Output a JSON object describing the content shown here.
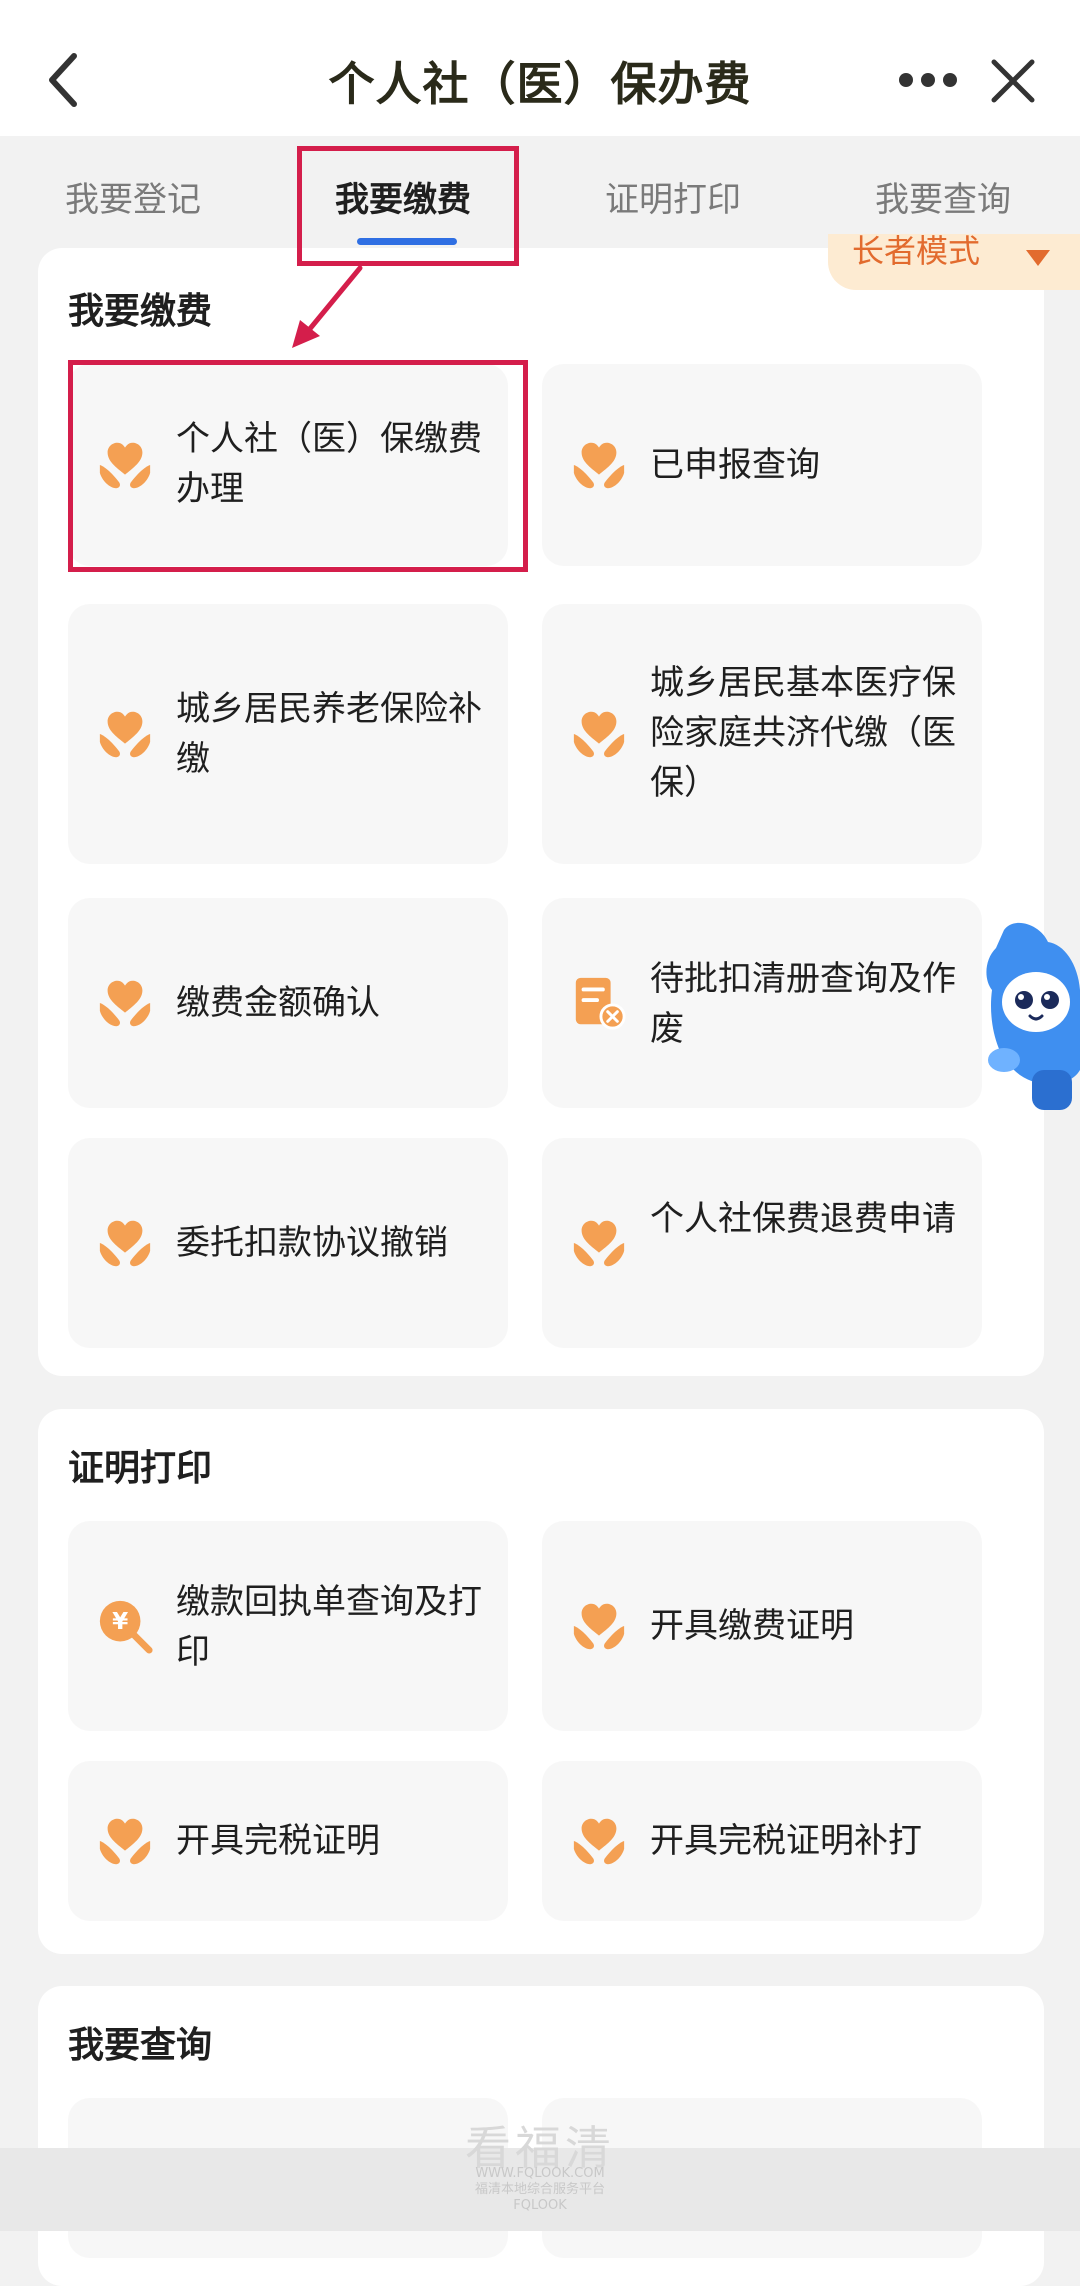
{
  "header": {
    "title": "个人社（医）保办费",
    "back_icon": "chevron-left-icon",
    "more_icon": "more-dots-icon",
    "close_icon": "close-icon"
  },
  "tabs": [
    {
      "label": "我要登记",
      "active": false
    },
    {
      "label": "我要缴费",
      "active": true
    },
    {
      "label": "证明打印",
      "active": false
    },
    {
      "label": "我要查询",
      "active": false
    }
  ],
  "mode_badge": "长者模式",
  "sections": [
    {
      "title": "我要缴费",
      "items": [
        {
          "label": "个人社（医）保缴费办理",
          "icon": "heart-hands-icon"
        },
        {
          "label": "已申报查询",
          "icon": "heart-hands-icon"
        },
        {
          "label": "城乡居民养老保险补缴",
          "icon": "heart-hands-icon"
        },
        {
          "label": "城乡居民基本医疗保险家庭共济代缴（医保）",
          "icon": "heart-hands-icon"
        },
        {
          "label": "缴费金额确认",
          "icon": "heart-hands-icon"
        },
        {
          "label": "待批扣清册查询及作废",
          "icon": "document-cancel-icon"
        },
        {
          "label": "委托扣款协议撤销",
          "icon": "heart-hands-icon"
        },
        {
          "label": "个人社保费退费申请",
          "icon": "heart-hands-icon"
        }
      ]
    },
    {
      "title": "证明打印",
      "items": [
        {
          "label": "缴款回执单查询及打印",
          "icon": "yuan-search-icon"
        },
        {
          "label": "开具缴费证明",
          "icon": "heart-hands-icon"
        },
        {
          "label": "开具完税证明",
          "icon": "heart-hands-icon"
        },
        {
          "label": "开具完税证明补打",
          "icon": "heart-hands-icon"
        }
      ]
    },
    {
      "title": "我要查询",
      "items": []
    }
  ],
  "watermark": {
    "title": "看福清",
    "line1": "WWW.FQLOOK.COM",
    "line2": "福清本地综合服务平台",
    "line3": "FQLOOK"
  },
  "colors": {
    "accent_blue": "#2f6fe3",
    "highlight_red": "#d41e4b",
    "icon_orange": "#f4a053",
    "badge_bg": "#fdebd2",
    "badge_text": "#e26b2e"
  }
}
